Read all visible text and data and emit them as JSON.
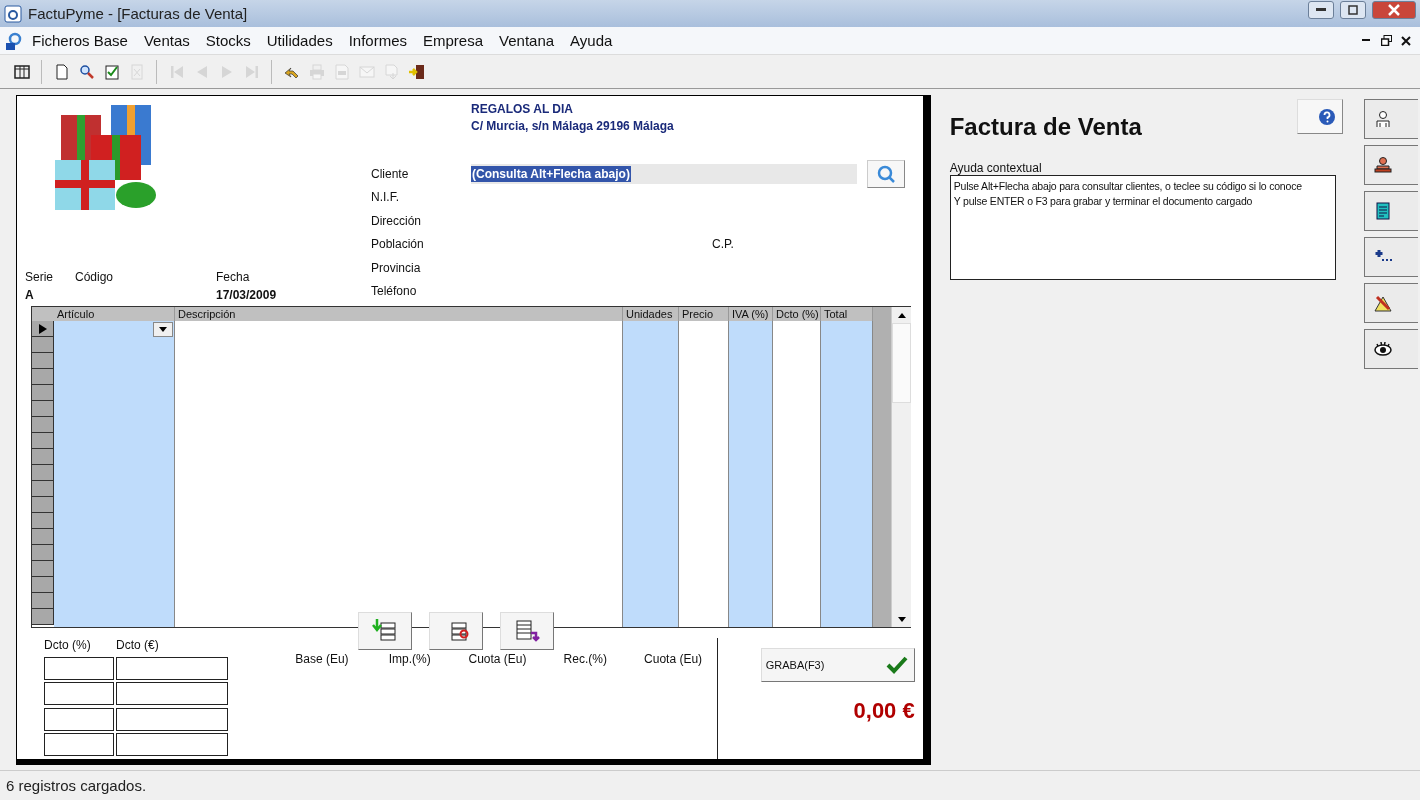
{
  "window": {
    "title": "FactuPyme - [Facturas de Venta]"
  },
  "menu": [
    {
      "label": "Ficheros Base"
    },
    {
      "label": "Ventas"
    },
    {
      "label": "Stocks"
    },
    {
      "label": "Utilidades"
    },
    {
      "label": "Informes"
    },
    {
      "label": "Empresa"
    },
    {
      "label": "Ventana"
    },
    {
      "label": "Ayuda"
    }
  ],
  "toolbar": [
    [
      {
        "kind": "grid",
        "disabled": false
      }
    ],
    [
      {
        "kind": "new",
        "disabled": false
      },
      {
        "kind": "search",
        "disabled": false
      },
      {
        "kind": "check",
        "disabled": false
      },
      {
        "kind": "delete",
        "disabled": true
      }
    ],
    [
      {
        "kind": "first",
        "disabled": true
      },
      {
        "kind": "prev",
        "disabled": true
      },
      {
        "kind": "next",
        "disabled": true
      },
      {
        "kind": "last",
        "disabled": true
      }
    ],
    [
      {
        "kind": "undo",
        "disabled": false
      },
      {
        "kind": "print",
        "disabled": true
      },
      {
        "kind": "pdf",
        "disabled": true
      },
      {
        "kind": "mail",
        "disabled": true
      },
      {
        "kind": "export",
        "disabled": true
      },
      {
        "kind": "exit",
        "disabled": false
      }
    ]
  ],
  "company": {
    "name": "REGALOS AL DIA",
    "address": "C/ Murcia, s/n Málaga 29196 Málaga"
  },
  "document": {
    "fields": [
      {
        "label": "Serie",
        "value": "A"
      },
      {
        "label": "Código"
      },
      {
        "label": "Fecha",
        "value": "17/03/2009"
      }
    ]
  },
  "customer": {
    "fields": [
      {
        "label": "Cliente",
        "kind": "lookup",
        "value": "(Consulta Alt+Flecha abajo)"
      },
      {
        "label": "N.I.F."
      },
      {
        "label": "Dirección"
      },
      {
        "label": "Población",
        "extra_label": "C.P."
      },
      {
        "label": "Provincia"
      },
      {
        "label": "Teléfono"
      }
    ]
  },
  "grid": {
    "columns": [
      {
        "label": "Artículo",
        "highlighted": true
      },
      {
        "label": "Descripción",
        "highlighted": false
      },
      {
        "label": "Unidades",
        "highlighted": true
      },
      {
        "label": "Precio",
        "highlighted": false
      },
      {
        "label": "IVA (%)",
        "highlighted": true
      },
      {
        "label": "Dcto (%)",
        "highlighted": false
      },
      {
        "label": "Total",
        "highlighted": true
      }
    ],
    "rows": [
      {
        "selected": true
      },
      {
        "selected": false
      },
      {
        "selected": false
      },
      {
        "selected": false
      },
      {
        "selected": false
      },
      {
        "selected": false
      },
      {
        "selected": false
      },
      {
        "selected": false
      },
      {
        "selected": false
      },
      {
        "selected": false
      },
      {
        "selected": false
      },
      {
        "selected": false
      },
      {
        "selected": false
      },
      {
        "selected": false
      },
      {
        "selected": false
      },
      {
        "selected": false
      },
      {
        "selected": false
      },
      {
        "selected": false
      },
      {
        "selected": false
      }
    ]
  },
  "line_buttons": [
    {
      "kind": "insert"
    },
    {
      "kind": "remove"
    },
    {
      "kind": "move"
    }
  ],
  "discounts": {
    "columns": [
      "Dcto (%)",
      "Dcto (€)"
    ]
  },
  "taxes": [
    "Base (Eu)",
    "Imp.(%)",
    "Cuota (Eu)",
    "Rec.(%)",
    "Cuota (Eu)"
  ],
  "save_button": {
    "label": "GRABA(F3)"
  },
  "total": "0,00 €",
  "panel": {
    "title": "Factura de Venta",
    "help_label": "Ayuda contextual",
    "help_lines": [
      "Pulse Alt+Flecha abajo para consultar clientes, o teclee su código si lo conoce",
      "Y pulse ENTER o F3 para grabar y terminar el documento cargado"
    ]
  },
  "side_buttons": [
    {
      "kind": "person"
    },
    {
      "kind": "person-red"
    },
    {
      "kind": "document"
    },
    {
      "kind": "add"
    },
    {
      "kind": "edit"
    },
    {
      "kind": "eye"
    }
  ],
  "status_bar": "6 registros cargados."
}
